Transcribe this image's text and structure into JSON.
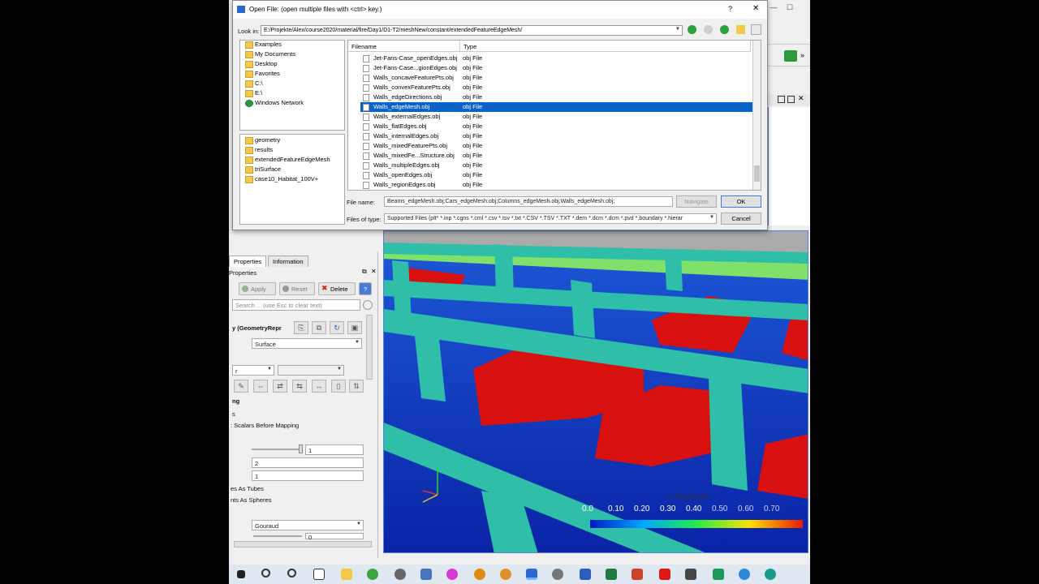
{
  "dialog": {
    "title": "Open File:  (open multiple files with <ctrl> key.)",
    "help": "?",
    "close": "✕",
    "look_in_label": "Look in:",
    "look_in_path": "E:/Projekte/Alex/course2020/material/fire/Day1/D1-T2/meshNew/constant/extendedFeatureEdgeMesh/",
    "places": [
      "Examples",
      "My Documents",
      "Desktop",
      "Favorites",
      "C:\\",
      "E:\\",
      "Windows Network"
    ],
    "recent": [
      "geometry",
      "results",
      "extendedFeatureEdgeMesh",
      "triSurface",
      "case10_Habitat_100V+"
    ],
    "col_filename": "Filename",
    "col_type": "Type",
    "files": [
      {
        "name": "Jet-Fans-Case_openEdges.obj",
        "type": "obj File"
      },
      {
        "name": "Jet-Fans-Case...gionEdges.obj",
        "type": "obj File"
      },
      {
        "name": "Walls_concaveFeaturePts.obj",
        "type": "obj File"
      },
      {
        "name": "Walls_convexFeaturePts.obj",
        "type": "obj File"
      },
      {
        "name": "Walls_edgeDirections.obj",
        "type": "obj File"
      },
      {
        "name": "Walls_edgeMesh.obj",
        "type": "obj File"
      },
      {
        "name": "Walls_externalEdges.obj",
        "type": "obj File"
      },
      {
        "name": "Walls_flatEdges.obj",
        "type": "obj File"
      },
      {
        "name": "Walls_internalEdges.obj",
        "type": "obj File"
      },
      {
        "name": "Walls_mixedFeaturePts.obj",
        "type": "obj File"
      },
      {
        "name": "Walls_mixedFe...Structure.obj",
        "type": "obj File"
      },
      {
        "name": "Walls_multipleEdges.obj",
        "type": "obj File"
      },
      {
        "name": "Walls_openEdges.obj",
        "type": "obj File"
      },
      {
        "name": "Walls_regionEdges.obj",
        "type": "obj File"
      }
    ],
    "selected_file": "Walls_edgeMesh.obj",
    "filename_label": "File name:",
    "filename_value": "Beams_edgeMesh.obj;Cars_edgeMesh.obj;Columns_edgeMesh.obj;Walls_edgeMesh.obj;",
    "filetype_label": "Files of type:",
    "filetype_value": "Supported Files (plt* *.inp *.cgns *.cml *.csv *.tsv *.txt *.CSV *.TSV *.TXT *.dem *.dcm *.dcm *.pvd *.boundary *.hierar",
    "navigate": "Navigate",
    "ok": "OK",
    "cancel": "Cancel"
  },
  "panel": {
    "tab_properties": "Properties",
    "tab_information": "Information",
    "header": "Properties",
    "apply": "Apply",
    "reset": "Reset",
    "delete": "Delete",
    "help": "?",
    "search_placeholder": "Search ... (use Esc to clear text)",
    "group_title": "y (GeometryRepr",
    "representation": "Surface",
    "combo_left": "r",
    "section_mapping": "ng",
    "label_s": "s",
    "label_scalars": ": Scalars Before Mapping",
    "slider_value": "1",
    "field_2": "2",
    "field_1": "1",
    "label_tubes": "es As Tubes",
    "label_spheres": "nts As Spheres",
    "interpolation": "Gouraud",
    "slider2_value": "0"
  },
  "viewport": {
    "legend_title": "U Magnitude",
    "legend_ticks": [
      "0.0",
      "0.10",
      "0.20",
      "0.30",
      "0.40",
      "0.50",
      "0.60",
      "0.70"
    ]
  },
  "window": {
    "minimize": "—",
    "maximize": "☐",
    "close": "✕"
  }
}
